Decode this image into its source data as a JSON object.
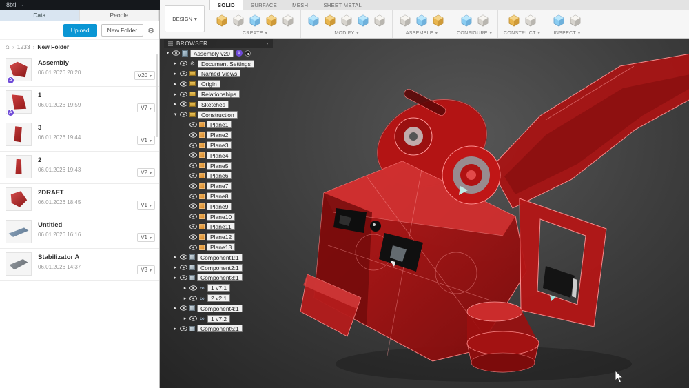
{
  "titlebar": {
    "app_label": "8btl"
  },
  "toolbar": {
    "design_label": "DESIGN",
    "tabs": [
      {
        "label": "SOLID"
      },
      {
        "label": "SURFACE"
      },
      {
        "label": "MESH"
      },
      {
        "label": "SHEET METAL"
      }
    ],
    "groups": [
      {
        "label": "CREATE"
      },
      {
        "label": "MODIFY"
      },
      {
        "label": "ASSEMBLE"
      },
      {
        "label": "CONFIGURE"
      },
      {
        "label": "CONSTRUCT"
      },
      {
        "label": "INSPECT"
      }
    ]
  },
  "data_panel": {
    "tabs": {
      "data": "Data",
      "people": "People"
    },
    "upload": "Upload",
    "new_folder": "New Folder",
    "breadcrumb": {
      "parent": "1233",
      "current": "New Folder"
    },
    "items": [
      {
        "name": "Assembly",
        "date": "06.01.2026 20:20",
        "version": "V20",
        "thumbClass": "t-red1",
        "avatar": "A"
      },
      {
        "name": "1",
        "date": "06.01.2026 19:59",
        "version": "V7",
        "thumbClass": "t-red2",
        "avatar": "A"
      },
      {
        "name": "3",
        "date": "06.01.2026 19:44",
        "version": "V1",
        "thumbClass": "t-red3",
        "avatar": ""
      },
      {
        "name": "2",
        "date": "06.01.2026 19:43",
        "version": "V2",
        "thumbClass": "t-red4",
        "avatar": ""
      },
      {
        "name": "2DRAFT",
        "date": "06.01.2026 18:45",
        "version": "V1",
        "thumbClass": "t-red5",
        "avatar": ""
      },
      {
        "name": "Untitled",
        "date": "06.01.2026 16:16",
        "version": "V1",
        "thumbClass": "t-blue",
        "avatar": ""
      },
      {
        "name": "Stabilizator A",
        "date": "06.01.2026 14:37",
        "version": "V3",
        "thumbClass": "t-gray",
        "avatar": ""
      }
    ]
  },
  "browser": {
    "title": "BROWSER",
    "root": {
      "label": "Assembly v20",
      "avatar": "A"
    },
    "nodes": [
      {
        "label": "Document Settings",
        "indentClass": "ind-1",
        "arrowClass": "arrow-right",
        "iconClass": "icon-gear"
      },
      {
        "label": "Named Views",
        "indentClass": "ind-1",
        "arrowClass": "arrow-right",
        "iconClass": "icon-folder"
      },
      {
        "label": "Origin",
        "indentClass": "ind-1",
        "arrowClass": "arrow-right",
        "iconClass": "icon-folder"
      },
      {
        "label": "Relationships",
        "indentClass": "ind-1",
        "arrowClass": "arrow-right",
        "iconClass": "icon-folder"
      },
      {
        "label": "Sketches",
        "indentClass": "ind-1",
        "arrowClass": "arrow-right",
        "iconClass": "icon-folder"
      },
      {
        "label": "Construction",
        "indentClass": "ind-1",
        "arrowClass": "arrow-down",
        "iconClass": "icon-folder"
      },
      {
        "label": "Plane1",
        "indentClass": "ind-2",
        "arrowClass": "arrow-none",
        "iconClass": "icon-plane"
      },
      {
        "label": "Plane2",
        "indentClass": "ind-2",
        "arrowClass": "arrow-none",
        "iconClass": "icon-plane"
      },
      {
        "label": "Plane3",
        "indentClass": "ind-2",
        "arrowClass": "arrow-none",
        "iconClass": "icon-plane"
      },
      {
        "label": "Plane4",
        "indentClass": "ind-2",
        "arrowClass": "arrow-none",
        "iconClass": "icon-plane"
      },
      {
        "label": "Plane5",
        "indentClass": "ind-2",
        "arrowClass": "arrow-none",
        "iconClass": "icon-plane"
      },
      {
        "label": "Plane6",
        "indentClass": "ind-2",
        "arrowClass": "arrow-none",
        "iconClass": "icon-plane"
      },
      {
        "label": "Plane7",
        "indentClass": "ind-2",
        "arrowClass": "arrow-none",
        "iconClass": "icon-plane"
      },
      {
        "label": "Plane8",
        "indentClass": "ind-2",
        "arrowClass": "arrow-none",
        "iconClass": "icon-plane"
      },
      {
        "label": "Plane9",
        "indentClass": "ind-2",
        "arrowClass": "arrow-none",
        "iconClass": "icon-plane"
      },
      {
        "label": "Plane10",
        "indentClass": "ind-2",
        "arrowClass": "arrow-none",
        "iconClass": "icon-plane"
      },
      {
        "label": "Plane11",
        "indentClass": "ind-2",
        "arrowClass": "arrow-none",
        "iconClass": "icon-plane"
      },
      {
        "label": "Plane12",
        "indentClass": "ind-2",
        "arrowClass": "arrow-none",
        "iconClass": "icon-plane"
      },
      {
        "label": "Plane13",
        "indentClass": "ind-2",
        "arrowClass": "arrow-none",
        "iconClass": "icon-plane"
      },
      {
        "label": "Component1:1",
        "indentClass": "ind-1",
        "arrowClass": "arrow-right",
        "iconClass": "icon-component"
      },
      {
        "label": "Component2:1",
        "indentClass": "ind-1",
        "arrowClass": "arrow-right",
        "iconClass": "icon-component"
      },
      {
        "label": "Component3:1",
        "indentClass": "ind-1",
        "arrowClass": "arrow-right",
        "iconClass": "icon-component"
      },
      {
        "label": "1 v7:1",
        "indentClass": "ind-2",
        "arrowClass": "arrow-right",
        "iconClass": "icon-link"
      },
      {
        "label": "2 v2:1",
        "indentClass": "ind-2",
        "arrowClass": "arrow-right",
        "iconClass": "icon-link"
      },
      {
        "label": "Component4:1",
        "indentClass": "ind-1",
        "arrowClass": "arrow-right",
        "iconClass": "icon-component"
      },
      {
        "label": "1 v7:2",
        "indentClass": "ind-2",
        "arrowClass": "arrow-right",
        "iconClass": "icon-link"
      },
      {
        "label": "Component5:1",
        "indentClass": "ind-1",
        "arrowClass": "arrow-right",
        "iconClass": "icon-component"
      }
    ]
  }
}
